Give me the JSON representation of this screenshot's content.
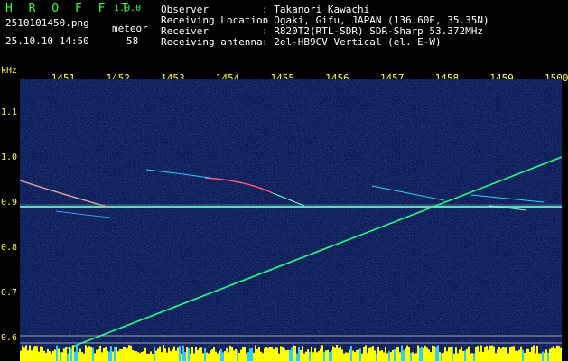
{
  "app": {
    "title": "H R O F F T",
    "version": "1.0.0"
  },
  "capture": {
    "filename": "2510101450.png",
    "datetime": "25.10.10 14:50",
    "meteor_label": "meteor",
    "meteor_count": "58"
  },
  "info": {
    "observer_label": "Observer",
    "observer_value": ": Takanori Kawachi",
    "location_label": "Receiving Location",
    "location_value": ": Ogaki, Gifu, JAPAN (136.60E, 35.35N)",
    "receiver_label": "Receiver",
    "receiver_value": ": R820T2(RTL-SDR) SDR-Sharp 53.372MHz",
    "antenna_label": "Receiving antenna",
    "antenna_value": ": 2el-HB9CV Vertical (el. E-W)"
  },
  "axis": {
    "y_unit": "kHz",
    "y_ticks": [
      "1.1",
      "1.0",
      "0.9",
      "0.8",
      "0.7",
      "0.6"
    ],
    "x_ticks": [
      "1451",
      "1452",
      "1453",
      "1454",
      "1455",
      "1456",
      "1457",
      "1458",
      "1459",
      "1500"
    ]
  },
  "colors": {
    "background": "#000000",
    "waterfall": "#0a1850",
    "accent_green": "#33ff33",
    "tick_yellow": "#ffff33",
    "meteor_trace": "#22ff88",
    "baseline": "#ffff00"
  }
}
